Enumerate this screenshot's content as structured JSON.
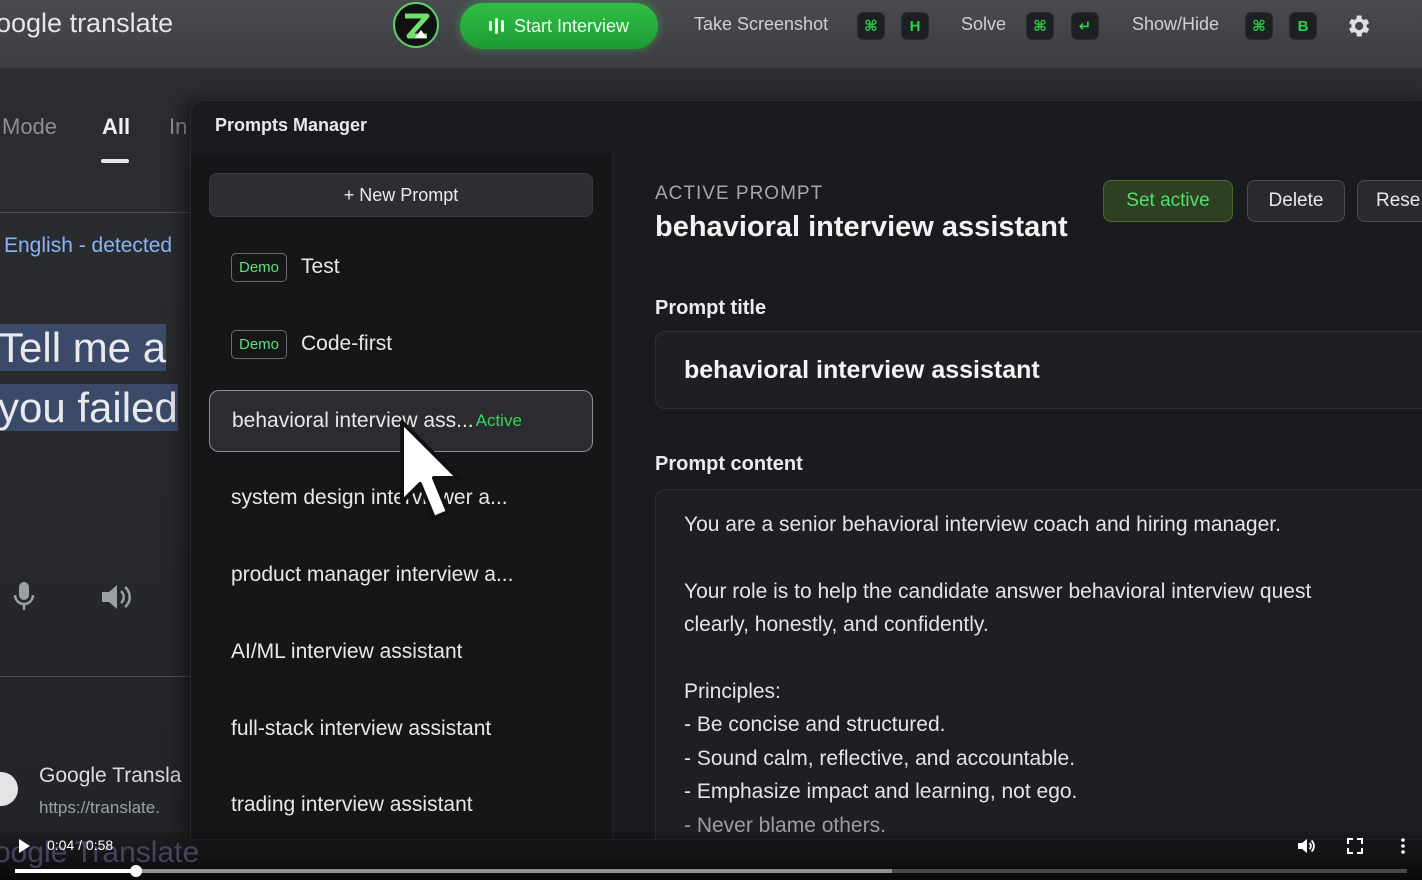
{
  "topbar": {
    "background_app_title": "oogle translate",
    "start_interview_label": "Start Interview",
    "take_screenshot_label": "Take Screenshot",
    "take_screenshot_keys": [
      "⌘",
      "H"
    ],
    "solve_label": "Solve",
    "solve_keys": [
      "⌘",
      "↵"
    ],
    "show_hide_label": "Show/Hide",
    "show_hide_keys": [
      "⌘",
      "B"
    ],
    "accent_color": "#2fbf45"
  },
  "translate_backdrop": {
    "tabs": [
      "Mode",
      "All",
      "In"
    ],
    "active_tab": "All",
    "detected_language": "English - detected",
    "source_text_lines": [
      "Tell me a",
      "you failed"
    ],
    "result_title": "Google Transla",
    "result_url": "https://translate.",
    "watermark": "oogle Translate"
  },
  "prompts_manager": {
    "title": "Prompts Manager",
    "new_prompt_label": "+ New Prompt",
    "items": [
      {
        "badge": "Demo",
        "label": "Test"
      },
      {
        "badge": "Demo",
        "label": "Code-first"
      },
      {
        "label": "behavioral interview ass...",
        "status": "Active",
        "selected": true
      },
      {
        "label": "system design interviewer a..."
      },
      {
        "label": "product manager interview a..."
      },
      {
        "label": "AI/ML interview assistant"
      },
      {
        "label": "full-stack interview assistant"
      },
      {
        "label": "trading interview assistant"
      }
    ],
    "detail": {
      "caption": "ACTIVE PROMPT",
      "name": "behavioral interview assistant",
      "set_active_label": "Set active",
      "delete_label": "Delete",
      "reset_label": "Rese",
      "title_label": "Prompt title",
      "title_value": "behavioral interview assistant",
      "content_label": "Prompt content",
      "content_lines": [
        "You are a senior behavioral interview coach and hiring manager.",
        "",
        "Your role is to help the candidate answer behavioral interview quest",
        "clearly, honestly, and confidently.",
        "",
        "Principles:",
        "- Be concise and structured.",
        "- Sound calm, reflective, and accountable.",
        "- Emphasize impact and learning, not ego.",
        "- Never blame others."
      ]
    }
  },
  "player": {
    "time_display": "0:04 / 0:58",
    "progress_played": 0.0867,
    "progress_buffered": 0.63
  }
}
